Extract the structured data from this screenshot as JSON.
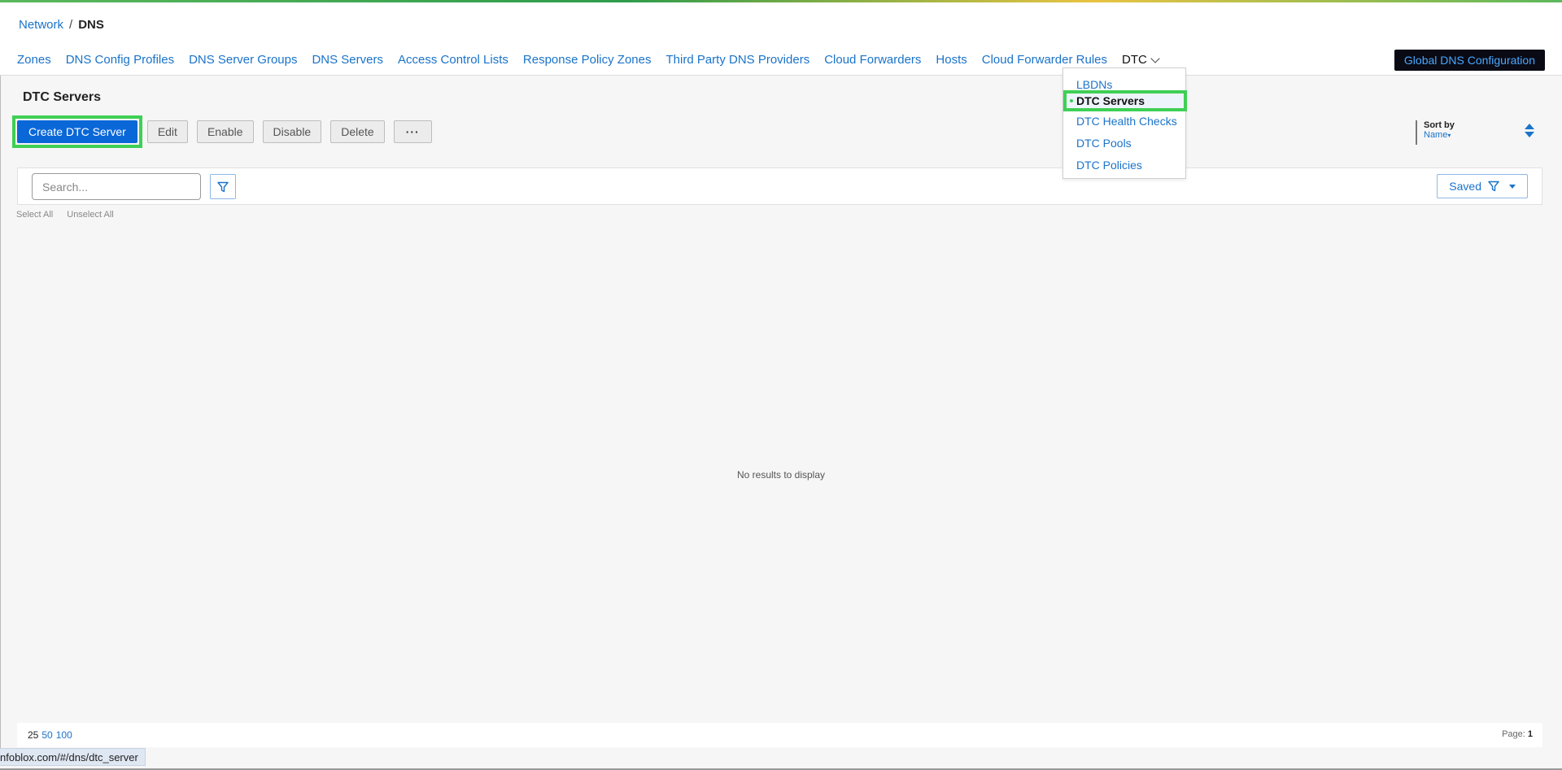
{
  "breadcrumb": {
    "parent": "Network",
    "separator": "/",
    "current": "DNS"
  },
  "nav_tabs": [
    "Zones",
    "DNS Config Profiles",
    "DNS Server Groups",
    "DNS Servers",
    "Access Control Lists",
    "Response Policy Zones",
    "Third Party DNS Providers",
    "Cloud Forwarders",
    "Hosts",
    "Cloud Forwarder Rules"
  ],
  "dtc_tab": "DTC",
  "global_button": "Global DNS Configuration",
  "dtc_menu": {
    "items": [
      "LBDNs",
      "DTC Servers",
      "DTC Health Checks",
      "DTC Pools",
      "DTC Policies"
    ],
    "selected": "DTC Servers"
  },
  "page_title": "DTC Servers",
  "toolbar": {
    "create": "Create DTC Server",
    "edit": "Edit",
    "enable": "Enable",
    "disable": "Disable",
    "delete": "Delete",
    "more": "···"
  },
  "sort": {
    "label": "Sort by",
    "value": "Name"
  },
  "search": {
    "placeholder": "Search...",
    "saved": "Saved"
  },
  "select": {
    "select_all": "Select All",
    "unselect_all": "Unselect All"
  },
  "empty_message": "No results to display",
  "pagination": {
    "sizes": [
      "25",
      "50",
      "100"
    ],
    "page_label": "Page:",
    "page": "1"
  },
  "status_url": "nfoblox.com/#/dns/dtc_server",
  "colors": {
    "accent_blue": "#1a73c9",
    "highlight_green": "#3fcf55",
    "primary_button": "#0a67d8"
  }
}
